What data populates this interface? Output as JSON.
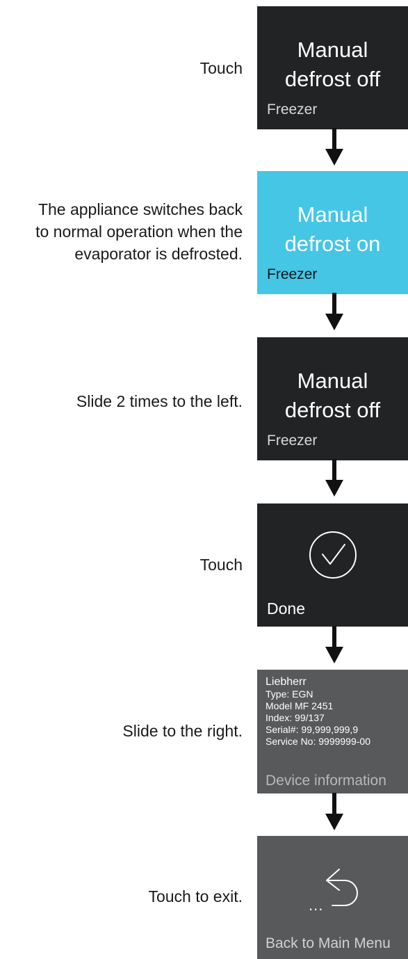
{
  "steps": [
    {
      "instruction": "Touch",
      "tile": {
        "title_line1": "Manual",
        "title_line2": "defrost off",
        "subtitle": "Freezer"
      }
    },
    {
      "instruction_line1": "The appliance switches back",
      "instruction_line2": "to normal operation when the",
      "instruction_line3": "evaporator is defrosted.",
      "tile": {
        "title_line1": "Manual",
        "title_line2": "defrost on",
        "subtitle": "Freezer"
      }
    },
    {
      "instruction": "Slide 2 times to the left.",
      "tile": {
        "title_line1": "Manual",
        "title_line2": "defrost off",
        "subtitle": "Freezer"
      }
    },
    {
      "instruction": "Touch",
      "tile": {
        "icon": "checkmark-circle-icon",
        "subtitle": "Done"
      }
    },
    {
      "instruction": "Slide to the right.",
      "tile": {
        "lines": [
          "Liebherr",
          "Type: EGN",
          "Model MF 2451",
          "Index: 99/137",
          "Serial#: 99,999,999,9",
          "Service No: 9999999-00"
        ],
        "caption": "Device information"
      }
    },
    {
      "instruction": "Touch to exit.",
      "tile": {
        "icon": "back-arrow-icon",
        "ellipsis": "...",
        "caption": "Back to Main Menu"
      }
    }
  ],
  "colors": {
    "tile_dark": "#222325",
    "tile_active": "#45c6e5",
    "tile_grey": "#58595b",
    "arrow": "#111111"
  }
}
